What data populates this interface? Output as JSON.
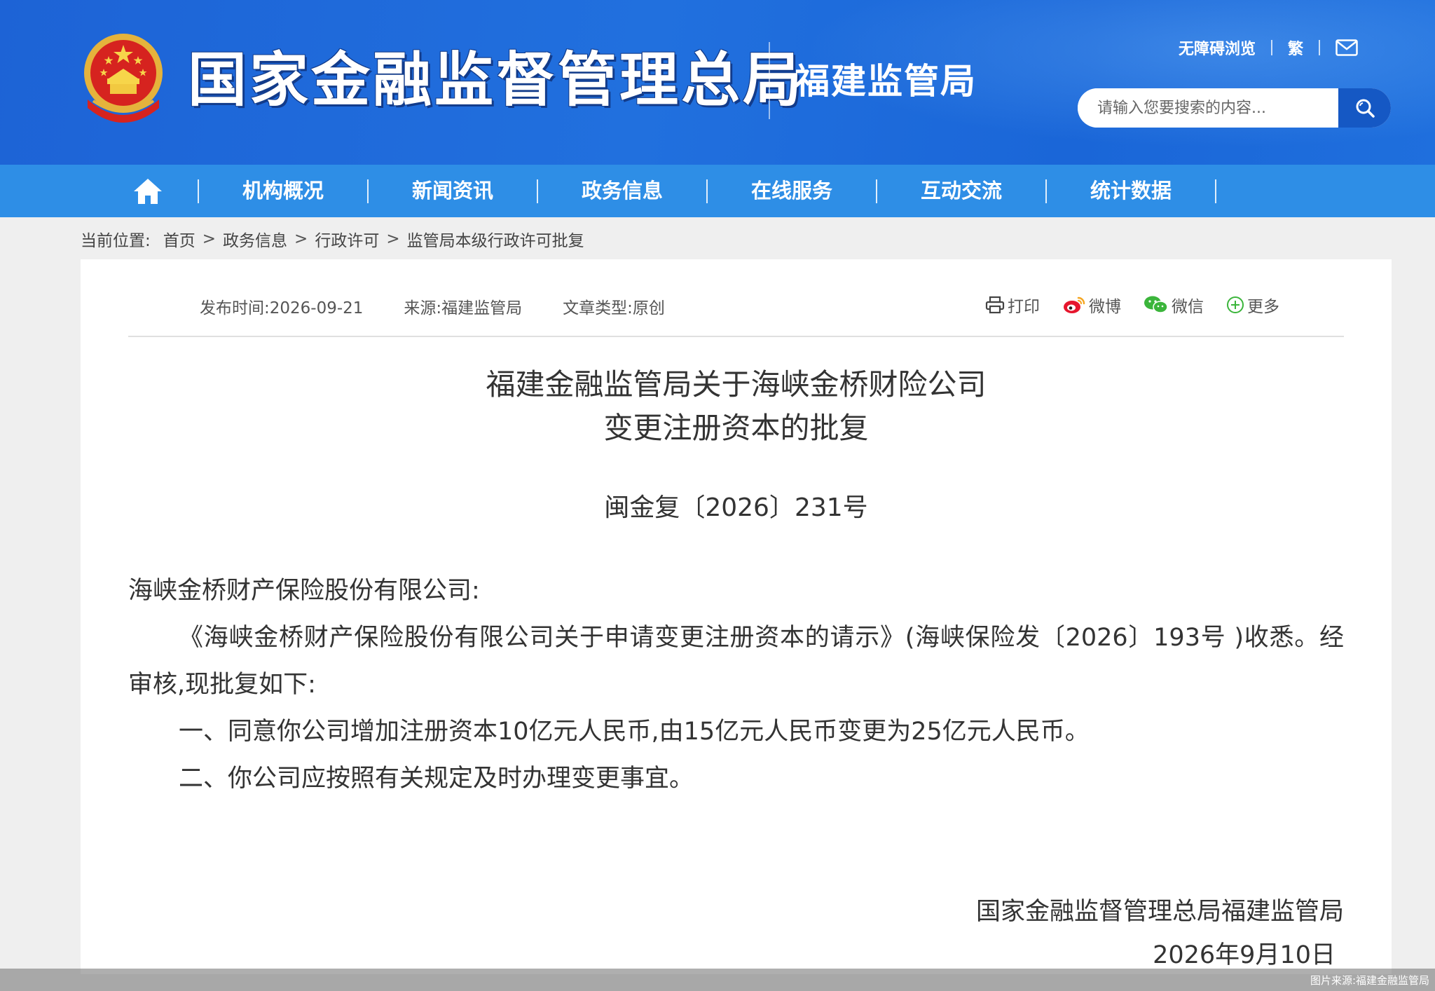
{
  "header": {
    "main_title": "国家金融监督管理总局",
    "sub_title": "福建监管局",
    "links": {
      "accessible": "无障碍浏览",
      "traditional": "繁"
    },
    "search_placeholder": "请输入您要搜索的内容..."
  },
  "nav": {
    "items": [
      "机构概况",
      "新闻资讯",
      "政务信息",
      "在线服务",
      "互动交流",
      "统计数据"
    ]
  },
  "breadcrumb": {
    "label": "当前位置:",
    "items": [
      "首页",
      "政务信息",
      "行政许可",
      "监管局本级行政许可批复"
    ],
    "separator": ">"
  },
  "meta": {
    "publish": "发布时间:2026-09-21",
    "source": "来源:福建监管局",
    "type": "文章类型:原创"
  },
  "share": {
    "print": "打印",
    "weibo": "微博",
    "wechat": "微信",
    "more": "更多"
  },
  "document": {
    "title_line1": "福建金融监管局关于海峡金桥财险公司",
    "title_line2": "变更注册资本的批复",
    "number": "闽金复〔2026〕231号",
    "addressee": "海峡金桥财产保险股份有限公司:",
    "para1": "《海峡金桥财产保险股份有限公司关于申请变更注册资本的请示》(海峡保险发〔2026〕193号 )收悉。经审核,现批复如下:",
    "item1": "一、同意你公司增加注册资本10亿元人民币,由15亿元人民币变更为25亿元人民币。",
    "item2": "二、你公司应按照有关规定及时办理变更事宜。",
    "signer": "国家金融监督管理总局福建监管局",
    "date": "2026年9月10日"
  },
  "caption": "图片来源:福建金融监管局",
  "colors": {
    "header_blue": "#1d63d6",
    "nav_blue": "#2e8ee6",
    "search_button": "#1558c4"
  }
}
